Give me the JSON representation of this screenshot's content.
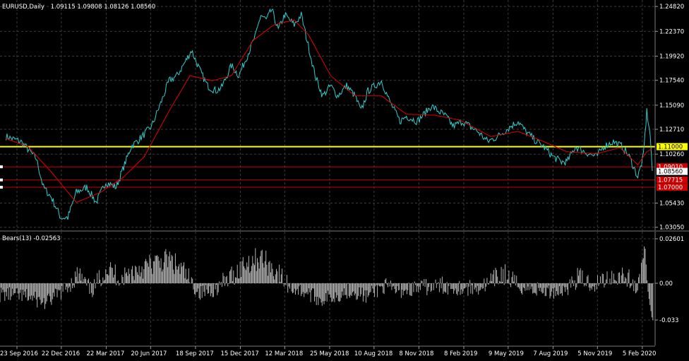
{
  "header": {
    "symbol_timeframe": "EURUSD,Daily",
    "ohlc": "1.09115 1.09808 1.08126 1.08560"
  },
  "indicator": {
    "label": "Bears(13) -0.02563",
    "axis_labels": [
      "0.02601",
      "0.00",
      "-0.033"
    ]
  },
  "colors": {
    "background": "#000000",
    "price_line": "#33cccc",
    "moving_average": "#e00000",
    "key_level": "#ffff00",
    "support_line": "#cc0000",
    "histogram": "#b4b4b4",
    "grid": "#3c3c3c",
    "text": "#ffffff"
  },
  "price_axis_labels": [
    "1.24820",
    "1.22370",
    "1.19920",
    "1.17540",
    "1.15090",
    "1.12710",
    "1.10260",
    "1.05430",
    "1.03050"
  ],
  "price_levels": [
    {
      "name": "key-level",
      "price": 1.11,
      "label": "1.11000",
      "kind": "yellow"
    },
    {
      "name": "support-1",
      "price": 1.0901,
      "label": "1.09010",
      "kind": "red"
    },
    {
      "name": "support-2",
      "price": 1.0856,
      "label": "1.08560",
      "kind": "current"
    },
    {
      "name": "support-3",
      "price": 1.07715,
      "label": "1.07715",
      "kind": "red"
    },
    {
      "name": "support-4",
      "price": 1.07,
      "label": "1.07000",
      "kind": "red"
    }
  ],
  "time_labels": [
    "23 Sep 2016",
    "22 Dec 2016",
    "22 Mar 2017",
    "20 Jun 2017",
    "18 Sep 2017",
    "15 Dec 2017",
    "12 Mar 2018",
    "25 May 2018",
    "10 Aug 2018",
    "8 Nov 2018",
    "8 Feb 2019",
    "9 May 2019",
    "7 Aug 2019",
    "5 Nov 2019",
    "5 Feb 2020"
  ],
  "chart_data": [
    {
      "type": "line",
      "series": [
        {
          "name": "EURUSD,Daily",
          "x": [
            "2016-09-01",
            "2016-10-01",
            "2016-11-01",
            "2016-11-15",
            "2016-12-01",
            "2016-12-20",
            "2017-01-03",
            "2017-01-20",
            "2017-02-10",
            "2017-03-01",
            "2017-03-20",
            "2017-04-10",
            "2017-04-25",
            "2017-05-10",
            "2017-06-01",
            "2017-06-20",
            "2017-07-10",
            "2017-07-25",
            "2017-08-10",
            "2017-08-28",
            "2017-09-08",
            "2017-09-25",
            "2017-10-10",
            "2017-10-27",
            "2017-11-07",
            "2017-11-27",
            "2017-12-12",
            "2017-12-29",
            "2018-01-15",
            "2018-01-25",
            "2018-02-05",
            "2018-02-16",
            "2018-03-01",
            "2018-03-14",
            "2018-04-02",
            "2018-04-16",
            "2018-04-30",
            "2018-05-14",
            "2018-05-29",
            "2018-06-14",
            "2018-06-28",
            "2018-07-16",
            "2018-08-02",
            "2018-08-14",
            "2018-08-28",
            "2018-09-24",
            "2018-10-10",
            "2018-10-31",
            "2018-11-13",
            "2018-12-05",
            "2019-01-02",
            "2019-01-31",
            "2019-02-15",
            "2019-03-05",
            "2019-03-20",
            "2019-04-05",
            "2019-04-25",
            "2019-05-15",
            "2019-06-10",
            "2019-06-25",
            "2019-07-10",
            "2019-08-01",
            "2019-08-15",
            "2019-09-03",
            "2019-09-20",
            "2019-10-01",
            "2019-10-18",
            "2019-11-05",
            "2019-11-29",
            "2019-12-13",
            "2020-01-02",
            "2020-01-20",
            "2020-02-03",
            "2020-02-20",
            "2020-03-02",
            "2020-03-09",
            "2020-03-16",
            "2020-03-20"
          ],
          "values": [
            1.12,
            1.115,
            1.098,
            1.07,
            1.06,
            1.04,
            1.04,
            1.065,
            1.07,
            1.055,
            1.075,
            1.07,
            1.09,
            1.11,
            1.12,
            1.13,
            1.155,
            1.175,
            1.18,
            1.195,
            1.205,
            1.185,
            1.17,
            1.165,
            1.168,
            1.19,
            1.18,
            1.2,
            1.22,
            1.24,
            1.235,
            1.245,
            1.225,
            1.24,
            1.23,
            1.24,
            1.21,
            1.18,
            1.16,
            1.17,
            1.16,
            1.17,
            1.16,
            1.145,
            1.165,
            1.175,
            1.155,
            1.135,
            1.14,
            1.135,
            1.15,
            1.14,
            1.13,
            1.135,
            1.13,
            1.125,
            1.115,
            1.12,
            1.13,
            1.135,
            1.125,
            1.115,
            1.11,
            1.1,
            1.095,
            1.095,
            1.11,
            1.105,
            1.1,
            1.11,
            1.115,
            1.11,
            1.1,
            1.08,
            1.1,
            1.145,
            1.12,
            1.086
          ]
        },
        {
          "name": "moving average",
          "x": [
            "2016-09-01",
            "2016-10-15",
            "2016-12-01",
            "2017-01-20",
            "2017-03-10",
            "2017-04-25",
            "2017-06-05",
            "2017-07-25",
            "2017-09-05",
            "2017-10-20",
            "2017-11-27",
            "2018-01-10",
            "2018-02-20",
            "2018-04-02",
            "2018-05-01",
            "2018-06-14",
            "2018-08-02",
            "2018-09-24",
            "2018-11-13",
            "2019-01-10",
            "2019-03-01",
            "2019-05-01",
            "2019-06-25",
            "2019-08-15",
            "2019-10-01",
            "2019-11-29",
            "2020-01-15",
            "2020-02-20",
            "2020-03-09",
            "2020-03-20"
          ],
          "values": [
            1.118,
            1.11,
            1.085,
            1.055,
            1.065,
            1.08,
            1.1,
            1.145,
            1.18,
            1.175,
            1.18,
            1.215,
            1.23,
            1.235,
            1.22,
            1.18,
            1.16,
            1.16,
            1.142,
            1.141,
            1.136,
            1.12,
            1.125,
            1.115,
            1.105,
            1.103,
            1.109,
            1.092,
            1.105,
            1.108
          ]
        }
      ]
    },
    {
      "type": "bar",
      "series": [
        {
          "name": "Bears(13)",
          "x": [
            "2016-09-01",
            "2016-10-15",
            "2016-11-20",
            "2016-12-20",
            "2017-01-25",
            "2017-02-20",
            "2017-03-20",
            "2017-04-20",
            "2017-05-20",
            "2017-06-20",
            "2017-07-25",
            "2017-08-25",
            "2017-09-25",
            "2017-10-25",
            "2017-11-25",
            "2017-12-25",
            "2018-01-25",
            "2018-02-25",
            "2018-03-25",
            "2018-04-25",
            "2018-05-25",
            "2018-06-25",
            "2018-07-25",
            "2018-08-25",
            "2018-09-25",
            "2018-10-25",
            "2018-11-25",
            "2018-12-25",
            "2019-01-25",
            "2019-02-25",
            "2019-03-25",
            "2019-04-25",
            "2019-05-25",
            "2019-06-25",
            "2019-07-25",
            "2019-08-25",
            "2019-09-25",
            "2019-10-25",
            "2019-11-25",
            "2019-12-25",
            "2020-01-25",
            "2020-02-20",
            "2020-03-05",
            "2020-03-12",
            "2020-03-20"
          ],
          "values": [
            -0.01,
            -0.012,
            -0.018,
            -0.008,
            0.005,
            -0.007,
            0.009,
            0.003,
            0.008,
            0.011,
            0.014,
            0.006,
            -0.009,
            -0.005,
            0.003,
            0.012,
            0.015,
            0.007,
            -0.004,
            -0.008,
            -0.015,
            -0.011,
            -0.006,
            -0.012,
            -0.003,
            -0.007,
            -0.005,
            -0.004,
            -0.003,
            -0.004,
            -0.005,
            -0.002,
            0.006,
            -0.003,
            -0.005,
            -0.008,
            -0.006,
            0.003,
            -0.002,
            0.004,
            0.005,
            -0.006,
            0.024,
            -0.01,
            -0.033
          ]
        }
      ]
    }
  ]
}
